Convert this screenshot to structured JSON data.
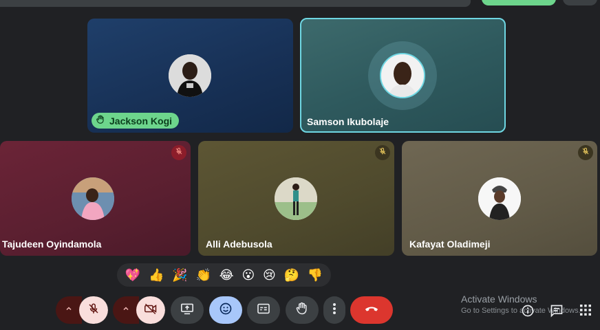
{
  "participants": {
    "jackson": {
      "name": "Jackson Kogi",
      "hand_raised": true
    },
    "samson": {
      "name": "Samson Ikubolaje",
      "speaking": true
    },
    "tajudeen": {
      "name": "Tajudeen Oyindamola",
      "muted": true
    },
    "alli": {
      "name": "Alli Adebusola",
      "muted": true
    },
    "kafayat": {
      "name": "Kafayat Oladimeji",
      "muted": true
    }
  },
  "reactions": [
    "💖",
    "👍",
    "🎉",
    "👏",
    "😂",
    "😮",
    "😢",
    "🤔",
    "👎"
  ],
  "watermark": {
    "line1": "Activate Windows",
    "line2": "Go to Settings to activate Windows."
  },
  "icons": {
    "mic": "mic-off-icon",
    "camera": "camera-off-icon",
    "present": "present-screen-icon",
    "reactions": "emoji-icon",
    "captions": "captions-icon",
    "hand": "raise-hand-icon",
    "more": "more-vert-icon",
    "leave": "call-end-icon",
    "info": "info-icon",
    "chat": "chat-icon",
    "activities": "apps-grid-icon"
  },
  "colors": {
    "background": "#202124",
    "active_speaker_border": "#6fd7e3",
    "hand_chip": "#6dd58c",
    "leave_button": "#dc362e",
    "toggle_off": "#f9dedc",
    "reaction_active": "#a8c7fa"
  }
}
